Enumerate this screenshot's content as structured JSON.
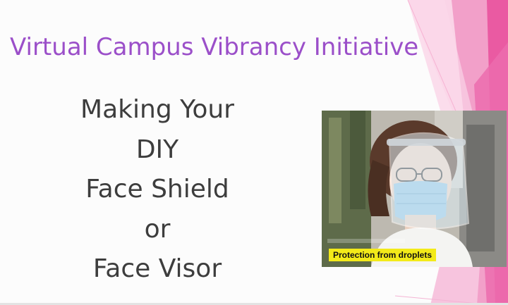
{
  "slide": {
    "title": "Virtual Campus Vibrancy Initiative",
    "body_lines": [
      "Making Your",
      "DIY",
      "Face Shield",
      "or",
      "Face Visor"
    ]
  },
  "photo": {
    "caption": "Protection from droplets",
    "subject_icon": "woman-wearing-face-shield-image"
  },
  "colors": {
    "title": "#9b4fc9",
    "accent_pink": "#e9559e",
    "accent_light_pink": "#f5a9cf",
    "caption_bg": "#f3ea19"
  }
}
